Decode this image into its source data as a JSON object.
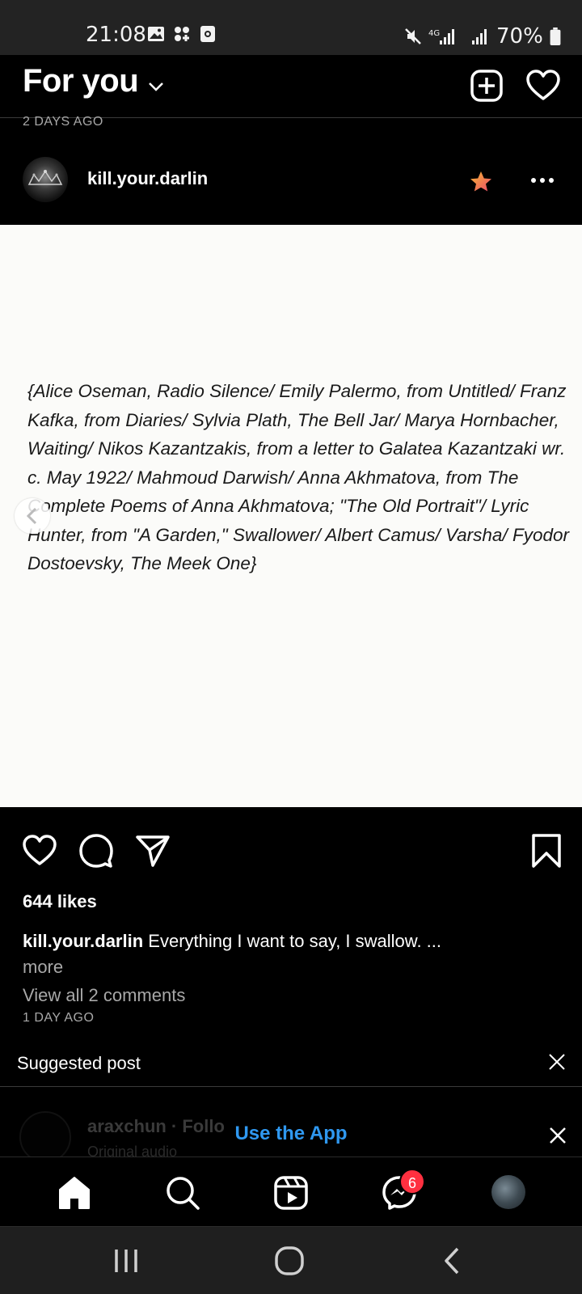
{
  "status_bar": {
    "time": "21:08",
    "battery": "70%",
    "network": "4G"
  },
  "header": {
    "title": "For you"
  },
  "post": {
    "time_above": "2 DAYS AGO",
    "username": "kill.your.darlin",
    "image_text": "{Alice Oseman, Radio Silence/ Emily Palermo, from Untitled/ Franz Kafka, from Diaries/ Sylvia Plath, The Bell Jar/ Marya Hornbacher, Waiting/ Nikos Kazantzakis, from a letter to Galatea Kazantzaki wr. c. May 1922/ Mahmoud Darwish/ Anna Akhmatova, from The Complete Poems of Anna Akhmatova; \"The Old Portrait\"/ Lyric Hunter, from \"A Garden,\" Swallower/ Albert Camus/ Varsha/ Fyodor Dostoevsky, The Meek One}",
    "likes": "644 likes",
    "caption_user": "kill.your.darlin",
    "caption_text": "Everything I want to say, I swallow. ...",
    "more": "more",
    "view_comments": "View all 2 comments",
    "time": "1 DAY AGO"
  },
  "suggested": {
    "label": "Suggested post",
    "next_user": "araxchun · Follo",
    "next_audio": "Original audio",
    "use_app": "Use the App"
  },
  "bottom_nav": {
    "messages_badge": "6"
  },
  "colors": {
    "link_blue": "#2f98f0",
    "badge_red": "#ff3040",
    "star": "#f0645a"
  },
  "icons": [
    "gallery-icon",
    "apps-icon",
    "screenshot-icon",
    "mute-icon",
    "signal-icon",
    "battery-icon",
    "chevron-down-icon",
    "add-post-icon",
    "heart-icon",
    "star-icon",
    "more-icon",
    "chevron-left-icon",
    "like-icon",
    "comment-icon",
    "share-icon",
    "bookmark-icon",
    "close-icon",
    "home-icon",
    "search-icon",
    "reels-icon",
    "messenger-icon",
    "recents-icon",
    "home-circle-icon",
    "back-icon"
  ]
}
